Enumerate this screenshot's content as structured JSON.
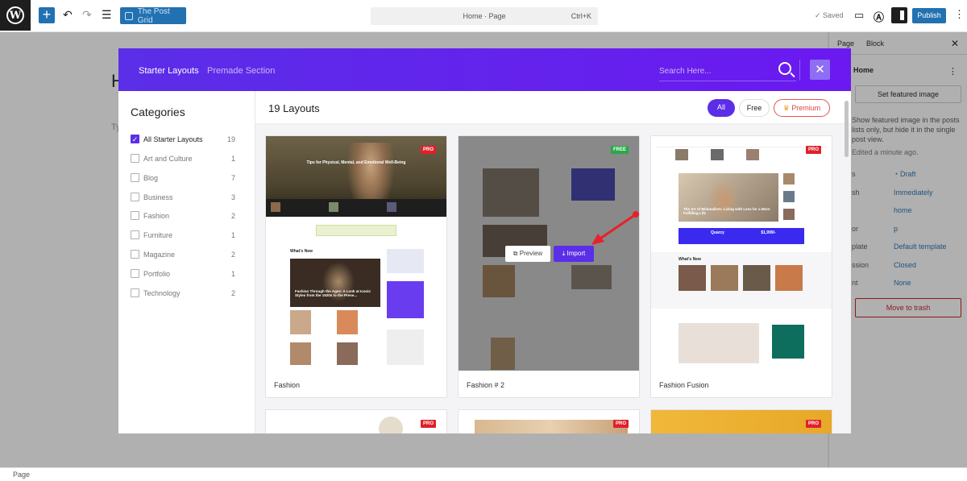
{
  "topbar": {
    "plugin_label": "The Post Grid",
    "command": {
      "title": "Home · Page",
      "shortcut": "Ctrl+K"
    },
    "saved_label": "Saved",
    "publish_label": "Publish"
  },
  "editor": {
    "heading": "H",
    "placeholder": "Ty"
  },
  "sidebar": {
    "tab_page": "Page",
    "tab_block": "Block",
    "title": "Home",
    "featured_button": "Set featured image",
    "note": "Show featured image in the posts lists only, but hide it in the single post view.",
    "edited": "Edited a minute ago.",
    "rows": [
      {
        "label": "s",
        "value": "Draft"
      },
      {
        "label": "sh",
        "value": "Immediately"
      },
      {
        "label": "",
        "value": "home"
      },
      {
        "label": "or",
        "value": "p"
      },
      {
        "label": "plate",
        "value": "Default template"
      },
      {
        "label": "ssion",
        "value": "Closed"
      },
      {
        "label": "nt",
        "value": "None"
      }
    ],
    "trash_label": "Move to trash"
  },
  "statusbar": {
    "label": "Page"
  },
  "modal": {
    "tabs": [
      "Starter Layouts",
      "Premade Section"
    ],
    "search_placeholder": "Search Here...",
    "close_glyph": "✕",
    "categories_title": "Categories",
    "categories": [
      {
        "label": "All Starter Layouts",
        "count": "19",
        "checked": true
      },
      {
        "label": "Art and Culture",
        "count": "1",
        "checked": false
      },
      {
        "label": "Blog",
        "count": "7",
        "checked": false
      },
      {
        "label": "Business",
        "count": "3",
        "checked": false
      },
      {
        "label": "Fashion",
        "count": "2",
        "checked": false
      },
      {
        "label": "Furniture",
        "count": "1",
        "checked": false
      },
      {
        "label": "Magazine",
        "count": "2",
        "checked": false
      },
      {
        "label": "Portfolio",
        "count": "1",
        "checked": false
      },
      {
        "label": "Technology",
        "count": "2",
        "checked": false
      }
    ],
    "layout_count": "19 Layouts",
    "filters": {
      "all": "All",
      "free": "Free",
      "premium": "Premium"
    },
    "cards": [
      {
        "name": "Fashion",
        "badge": "PRO",
        "hero_text": "Tips for Physical, Mental, and Emotional Well-Being",
        "section": "What's New",
        "feature_text": "Fashion Through the Ages: A Look at Iconic Styles from the 1920s to the Prese..."
      },
      {
        "name": "Fashion # 2",
        "badge": "FREE",
        "preview_label": "Preview",
        "import_label": "Import"
      },
      {
        "name": "Fashion Fusion",
        "badge": "PRO",
        "hero_text": "The Art of Minimalism: Living with Less for a More Fulfilling Life",
        "promo_price": "$1,999/-",
        "promo_brand": "Quarzy",
        "section": "What's New"
      }
    ],
    "row2_badges": [
      "PRO",
      "PRO",
      "PRO"
    ]
  },
  "colors": {
    "brand_purple": "#5b2ee8",
    "wp_blue": "#2271b1",
    "pro_red": "#e0202a",
    "free_green": "#2aa84a",
    "arrow_red": "#e8202a"
  }
}
